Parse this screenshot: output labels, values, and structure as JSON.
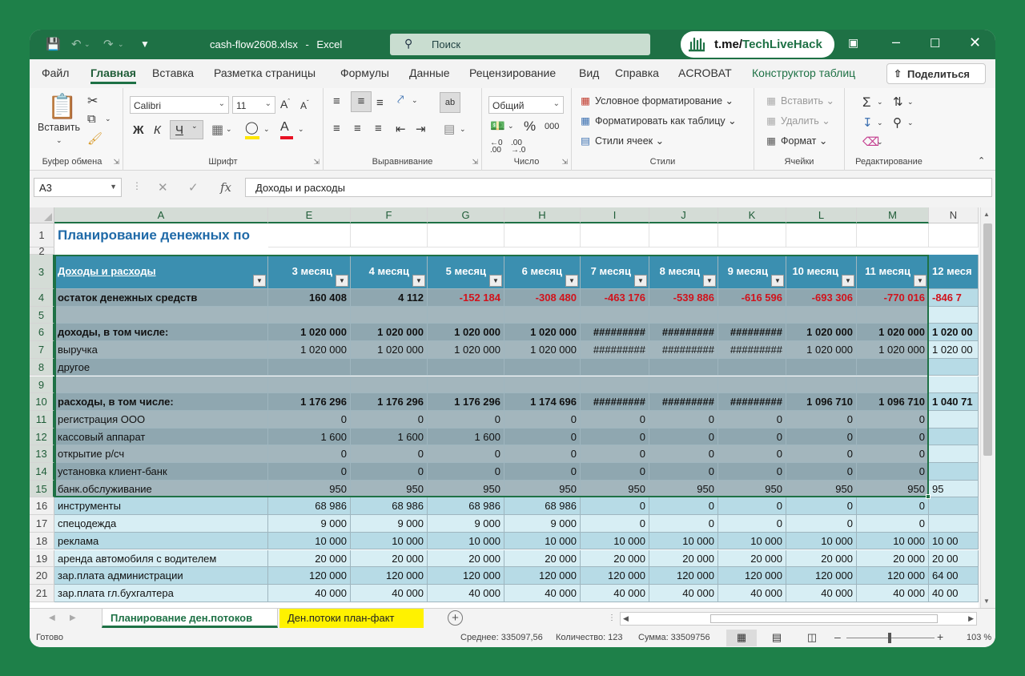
{
  "titlebar": {
    "filename": "cash-flow2608.xlsx",
    "separator": "-",
    "app": "Excel",
    "search_placeholder": "Поиск",
    "badge_prefix": "t.me/",
    "badge_brand": "TechLiveHack"
  },
  "menu": {
    "tabs": [
      "Файл",
      "Главная",
      "Вставка",
      "Разметка страницы",
      "Формулы",
      "Данные",
      "Рецензирование",
      "Вид",
      "Справка",
      "ACROBAT",
      "Конструктор таблиц"
    ],
    "active_tab": "Главная",
    "share": "Поделиться"
  },
  "ribbon": {
    "clipboard": {
      "paste": "Вставить",
      "label": "Буфер обмена"
    },
    "font": {
      "name": "Calibri",
      "size": "11",
      "bold": "Ж",
      "italic": "К",
      "underline": "Ч",
      "label": "Шрифт"
    },
    "alignment": {
      "label": "Выравнивание"
    },
    "number": {
      "format": "Общий",
      "percent": "%",
      "thousands": "000",
      "label": "Число"
    },
    "styles": {
      "conditional": "Условное форматирование",
      "as_table": "Форматировать как таблицу",
      "cell_styles": "Стили ячеек",
      "label": "Стили"
    },
    "cells": {
      "insert": "Вставить",
      "delete": "Удалить",
      "format": "Формат",
      "label": "Ячейки"
    },
    "editing": {
      "label": "Редактирование"
    }
  },
  "formula_bar": {
    "name_box": "A3",
    "fx": "fx",
    "content": "Доходы и расходы"
  },
  "grid": {
    "columns": [
      "A",
      "E",
      "F",
      "G",
      "H",
      "I",
      "J",
      "K",
      "L",
      "M",
      "N"
    ],
    "title": "Планирование денежных по",
    "header_label": "Доходы и расходы",
    "month_headers": [
      "3 месяц",
      "4 месяц",
      "5 месяц",
      "6 месяц",
      "7 месяц",
      "8 месяц",
      "9 месяц",
      "10 месяц",
      "11 месяц",
      "12 меся"
    ],
    "rows": [
      {
        "n": "4",
        "label": "остаток денежных средств",
        "bold": true,
        "values": [
          "160 408",
          "4 112",
          "-152 184",
          "-308 480",
          "-463 176",
          "-539 886",
          "-616 596",
          "-693 306",
          "-770 016",
          "-846 7"
        ]
      },
      {
        "n": "5",
        "label": "",
        "values": [
          "",
          "",
          "",
          "",
          "",
          "",
          "",
          "",
          "",
          ""
        ]
      },
      {
        "n": "6",
        "label": "доходы, в том числе:",
        "bold": true,
        "values": [
          "1 020 000",
          "1 020 000",
          "1 020 000",
          "1 020 000",
          "#########",
          "#########",
          "#########",
          "1 020 000",
          "1 020 000",
          "1 020 00"
        ]
      },
      {
        "n": "7",
        "label": "выручка",
        "values": [
          "1 020 000",
          "1 020 000",
          "1 020 000",
          "1 020 000",
          "#########",
          "#########",
          "#########",
          "1 020 000",
          "1 020 000",
          "1 020 00"
        ]
      },
      {
        "n": "8",
        "label": "другое",
        "values": [
          "",
          "",
          "",
          "",
          "",
          "",
          "",
          "",
          "",
          ""
        ]
      },
      {
        "n": "9",
        "label": "",
        "values": [
          "",
          "",
          "",
          "",
          "",
          "",
          "",
          "",
          "",
          ""
        ]
      },
      {
        "n": "10",
        "label": "расходы, в том числе:",
        "bold": true,
        "values": [
          "1 176 296",
          "1 176 296",
          "1 176 296",
          "1 174 696",
          "#########",
          "#########",
          "#########",
          "1 096 710",
          "1 096 710",
          "1 040 71"
        ]
      },
      {
        "n": "11",
        "label": "регистрация ООО",
        "values": [
          "0",
          "0",
          "0",
          "0",
          "0",
          "0",
          "0",
          "0",
          "0",
          ""
        ]
      },
      {
        "n": "12",
        "label": "кассовый аппарат",
        "values": [
          "1 600",
          "1 600",
          "1 600",
          "0",
          "0",
          "0",
          "0",
          "0",
          "0",
          ""
        ]
      },
      {
        "n": "13",
        "label": "открытие р/сч",
        "values": [
          "0",
          "0",
          "0",
          "0",
          "0",
          "0",
          "0",
          "0",
          "0",
          ""
        ]
      },
      {
        "n": "14",
        "label": "установка клиент-банк",
        "values": [
          "0",
          "0",
          "0",
          "0",
          "0",
          "0",
          "0",
          "0",
          "0",
          ""
        ]
      },
      {
        "n": "15",
        "label": "банк.обслуживание",
        "values": [
          "950",
          "950",
          "950",
          "950",
          "950",
          "950",
          "950",
          "950",
          "950",
          "95"
        ]
      },
      {
        "n": "16",
        "label": "инструменты",
        "values": [
          "68 986",
          "68 986",
          "68 986",
          "68 986",
          "0",
          "0",
          "0",
          "0",
          "0",
          ""
        ]
      },
      {
        "n": "17",
        "label": "спецодежда",
        "values": [
          "9 000",
          "9 000",
          "9 000",
          "9 000",
          "0",
          "0",
          "0",
          "0",
          "0",
          ""
        ]
      },
      {
        "n": "18",
        "label": "реклама",
        "values": [
          "10 000",
          "10 000",
          "10 000",
          "10 000",
          "10 000",
          "10 000",
          "10 000",
          "10 000",
          "10 000",
          "10 00"
        ]
      },
      {
        "n": "19",
        "label": "аренда автомобиля с водителем",
        "values": [
          "20 000",
          "20 000",
          "20 000",
          "20 000",
          "20 000",
          "20 000",
          "20 000",
          "20 000",
          "20 000",
          "20 00"
        ]
      },
      {
        "n": "20",
        "label": "зар.плата администрации",
        "values": [
          "120 000",
          "120 000",
          "120 000",
          "120 000",
          "120 000",
          "120 000",
          "120 000",
          "120 000",
          "120 000",
          "64 00"
        ]
      },
      {
        "n": "21",
        "label": "зар.плата гл.бухгалтера",
        "values": [
          "40 000",
          "40 000",
          "40 000",
          "40 000",
          "40 000",
          "40 000",
          "40 000",
          "40 000",
          "40 000",
          "40 00"
        ]
      }
    ]
  },
  "sheets": {
    "tabs": [
      "Планирование ден.потоков",
      "Ден.потоки план-факт"
    ],
    "active": "Планирование ден.потоков"
  },
  "status": {
    "ready": "Готово",
    "average": "Среднее: 335097,56",
    "count": "Количество: 123",
    "sum": "Сумма: 33509756",
    "zoom": "103 %"
  },
  "colors": {
    "excel_green": "#1e7145",
    "page_bg": "#1e8049",
    "header_teal": "#3b8fb0",
    "row_light": "#b7dbe6",
    "row_alt": "#d7eef4",
    "selection_gray": "#a8b4b8",
    "negative_red": "#d1131c",
    "title_blue": "#1f6aa8"
  }
}
